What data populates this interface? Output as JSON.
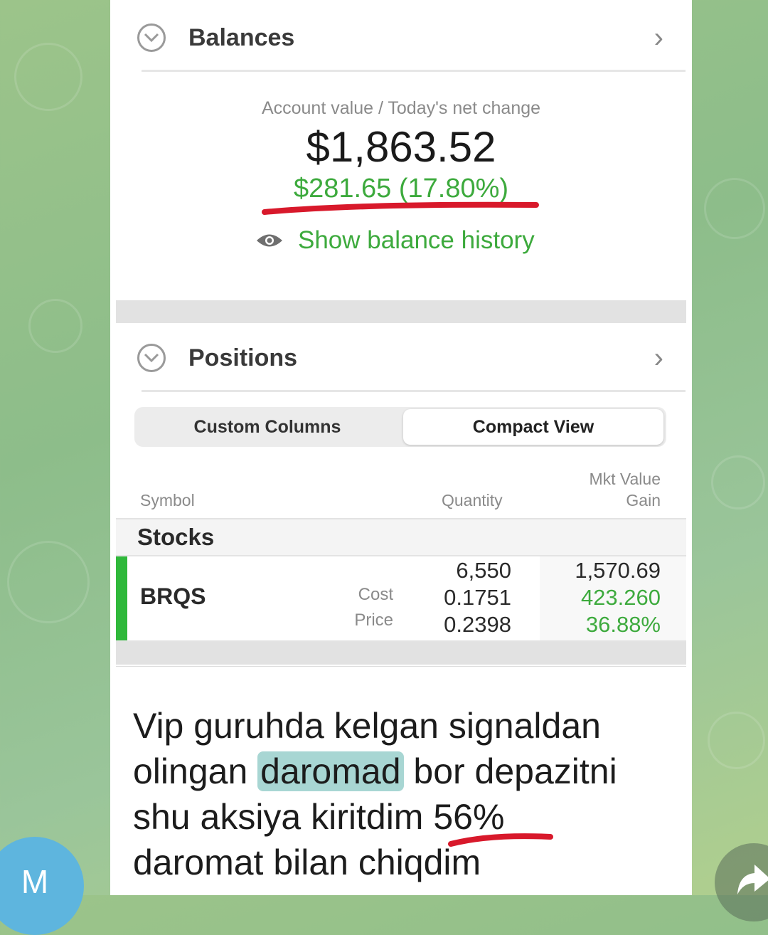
{
  "balances": {
    "title": "Balances",
    "account_label": "Account value / Today's net change",
    "account_value": "$1,863.52",
    "net_change": "$281.65 (17.80%)",
    "history_link": "Show balance history"
  },
  "positions": {
    "title": "Positions",
    "tabs": [
      "Custom Columns",
      "Compact View"
    ],
    "selected_tab": "Compact View",
    "columns": {
      "symbol": "Symbol",
      "quantity": "Quantity",
      "mkt_value": "Mkt Value",
      "gain": "Gain"
    },
    "group": "Stocks",
    "rows": [
      {
        "symbol": "BRQS",
        "labels": [
          "Cost",
          "Price"
        ],
        "quantity": "6,550",
        "cost": "0.1751",
        "price": "0.2398",
        "mkt_value": "1,570.69",
        "gain": "423.260",
        "gain_pct": "36.88%"
      }
    ]
  },
  "message": {
    "line1": "Vip guruhda kelgan signaldan",
    "line2_pre": "olingan ",
    "line2_highlight": "daromad",
    "line2_post": " bor depazitni",
    "line3": "shu aksiya kiritdim 56%",
    "line4": "daromat bilan chiqdim"
  },
  "avatar_letter": "M",
  "colors": {
    "gain_green": "#3daa3d",
    "underline_red": "#d8192b",
    "highlight": "#a8d6d3",
    "accent_bar": "#2fb83a"
  }
}
